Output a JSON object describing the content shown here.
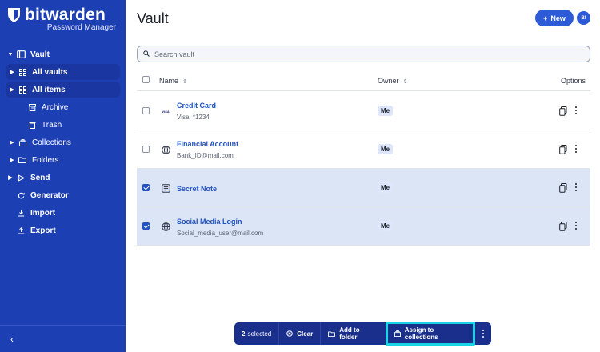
{
  "brand": {
    "name": "bitwarden",
    "product": "Password Manager"
  },
  "sidebar": {
    "items": [
      {
        "label": "Vault",
        "icon": "vault-icon"
      },
      {
        "label": "All vaults",
        "icon": "grid-icon"
      },
      {
        "label": "All items",
        "icon": "grid-icon"
      },
      {
        "label": "Archive",
        "icon": "archive-icon"
      },
      {
        "label": "Trash",
        "icon": "trash-icon"
      },
      {
        "label": "Collections",
        "icon": "collection-icon"
      },
      {
        "label": "Folders",
        "icon": "folder-icon"
      },
      {
        "label": "Send",
        "icon": "send-icon"
      },
      {
        "label": "Generator",
        "icon": "generator-icon"
      },
      {
        "label": "Import",
        "icon": "import-icon"
      },
      {
        "label": "Export",
        "icon": "export-icon"
      }
    ],
    "collapse_icon": "chevron-left-icon"
  },
  "header": {
    "title": "Vault",
    "new_label": "New",
    "avatar_initials": "BI"
  },
  "search": {
    "placeholder": "Search vault",
    "value": ""
  },
  "table": {
    "columns": {
      "name": "Name",
      "owner": "Owner",
      "options": "Options"
    },
    "rows": [
      {
        "name": "Credit Card",
        "subtitle": "Visa, *1234",
        "owner": "Me",
        "selected": false,
        "icon": "visa-icon",
        "icon_text": "VISA"
      },
      {
        "name": "Financial Account",
        "subtitle": "Bank_ID@mail.com",
        "owner": "Me",
        "selected": false,
        "icon": "globe-icon"
      },
      {
        "name": "Secret Note",
        "subtitle": "",
        "owner": "Me",
        "selected": true,
        "icon": "note-icon"
      },
      {
        "name": "Social Media Login",
        "subtitle": "Social_media_user@mail.com",
        "owner": "Me",
        "selected": true,
        "icon": "globe-icon"
      }
    ]
  },
  "bulk_actions": {
    "count": "2",
    "selected_label": "selected",
    "clear_label": "Clear",
    "add_to_folder_label": "Add to folder",
    "assign_label": "Assign to collections"
  },
  "colors": {
    "sidebar": "#1d3fb4",
    "accent": "#2153c4",
    "selected_row": "#dbe5f6",
    "bulk_bar": "#1a2f8c",
    "highlight": "#19d4e2"
  }
}
